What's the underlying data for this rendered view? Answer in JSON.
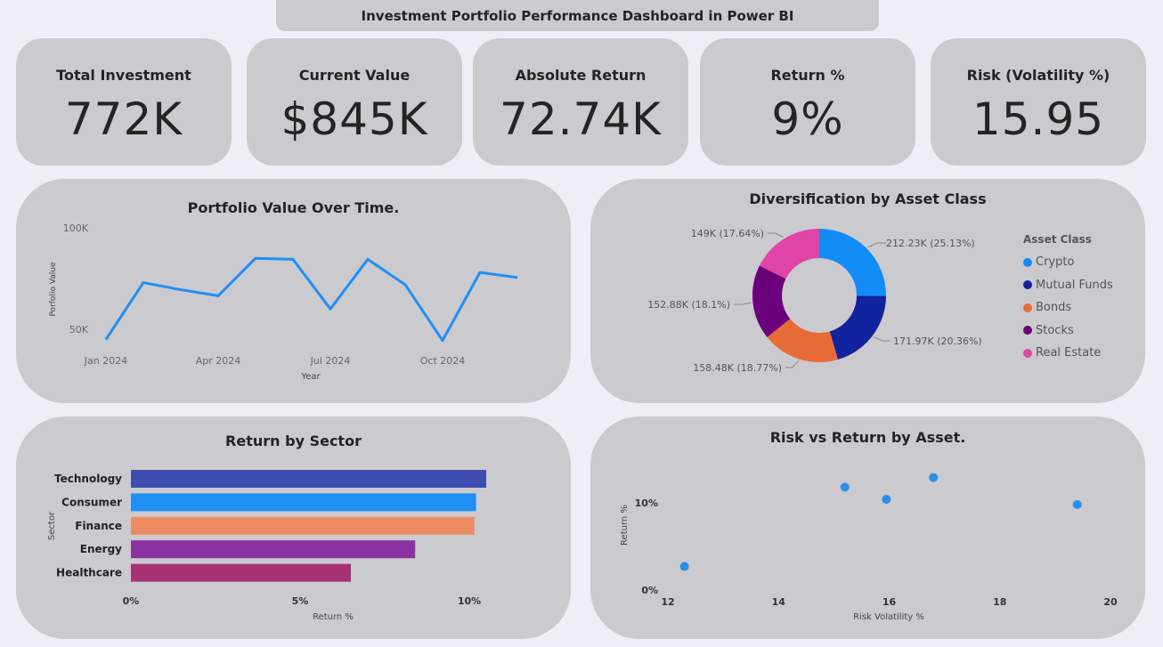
{
  "title": "Investment Portfolio Performance Dashboard in Power BI",
  "kpis": [
    {
      "label": "Total Investment",
      "value": "772K"
    },
    {
      "label": "Current Value",
      "value": "$845K"
    },
    {
      "label": "Absolute Return",
      "value": "72.74K"
    },
    {
      "label": "Return %",
      "value": "9%"
    },
    {
      "label": "Risk (Volatility %)",
      "value": "15.95"
    }
  ],
  "colors": {
    "background": "#efeef6",
    "card": "#cbcace",
    "line": "#1f8ff5",
    "crypto": "#128cf6",
    "mutual_funds": "#12239e",
    "bonds": "#e66c37",
    "stocks": "#6b007b",
    "real_estate": "#e044a7"
  },
  "chart_data": [
    {
      "type": "line",
      "title": "Portfolio Value Over Time.",
      "xlabel": "Year",
      "ylabel": "Porfolio Value",
      "x": [
        "2024-01",
        "2024-02",
        "2024-03",
        "2024-04",
        "2024-05",
        "2024-06",
        "2024-07",
        "2024-08",
        "2024-09",
        "2024-10",
        "2024-11",
        "2024-12"
      ],
      "x_ticks": [
        "Jan 2024",
        "Apr 2024",
        "Jul 2024",
        "Oct 2024"
      ],
      "y_ticks": [
        "100K",
        "50K"
      ],
      "ylim": [
        40000,
        100000
      ],
      "values": [
        45000,
        73000,
        69500,
        66500,
        85000,
        84500,
        60000,
        84500,
        72000,
        44500,
        78000,
        75500
      ],
      "grid": false
    },
    {
      "type": "pie",
      "title": "Diversification by Asset Class",
      "legend_title": "Asset Class",
      "legend_position": "right",
      "slices": [
        {
          "name": "Crypto",
          "value": 212230,
          "label": "212.23K (25.13%)",
          "color": "#128cf6"
        },
        {
          "name": "Mutual Funds",
          "value": 171970,
          "label": "171.97K (20.36%)",
          "color": "#12239e"
        },
        {
          "name": "Bonds",
          "value": 158480,
          "label": "158.48K (18.77%)",
          "color": "#e66c37"
        },
        {
          "name": "Stocks",
          "value": 152880,
          "label": "152.88K (18.1%)",
          "color": "#6b007b"
        },
        {
          "name": "Real Estate",
          "value": 149000,
          "label": "149K (17.64%)",
          "color": "#e044a7"
        }
      ]
    },
    {
      "type": "bar",
      "orientation": "horizontal",
      "title": "Return by Sector",
      "xlabel": "Return %",
      "ylabel": "Sector",
      "categories": [
        "Technology",
        "Consumer",
        "Finance",
        "Energy",
        "Healthcare"
      ],
      "values": [
        10.5,
        10.2,
        10.15,
        8.4,
        6.5
      ],
      "colors": [
        "#3f4db0",
        "#1f8ff5",
        "#ed8c63",
        "#8a33a0",
        "#a83075"
      ],
      "x_ticks": [
        "0%",
        "5%",
        "10%"
      ],
      "xlim": [
        0,
        11.5
      ]
    },
    {
      "type": "scatter",
      "title": "Risk vs Return by Asset.",
      "xlabel": "Risk Volatility %",
      "ylabel": "Return %",
      "x_ticks": [
        "12",
        "14",
        "16",
        "18",
        "20"
      ],
      "y_ticks": [
        "10%",
        "0%"
      ],
      "xlim": [
        12,
        20
      ],
      "ylim": [
        0,
        15
      ],
      "points": [
        {
          "x": 12.3,
          "y": 2.7
        },
        {
          "x": 15.2,
          "y": 11.8
        },
        {
          "x": 15.95,
          "y": 10.4
        },
        {
          "x": 16.8,
          "y": 12.9
        },
        {
          "x": 19.4,
          "y": 9.8
        }
      ]
    }
  ]
}
